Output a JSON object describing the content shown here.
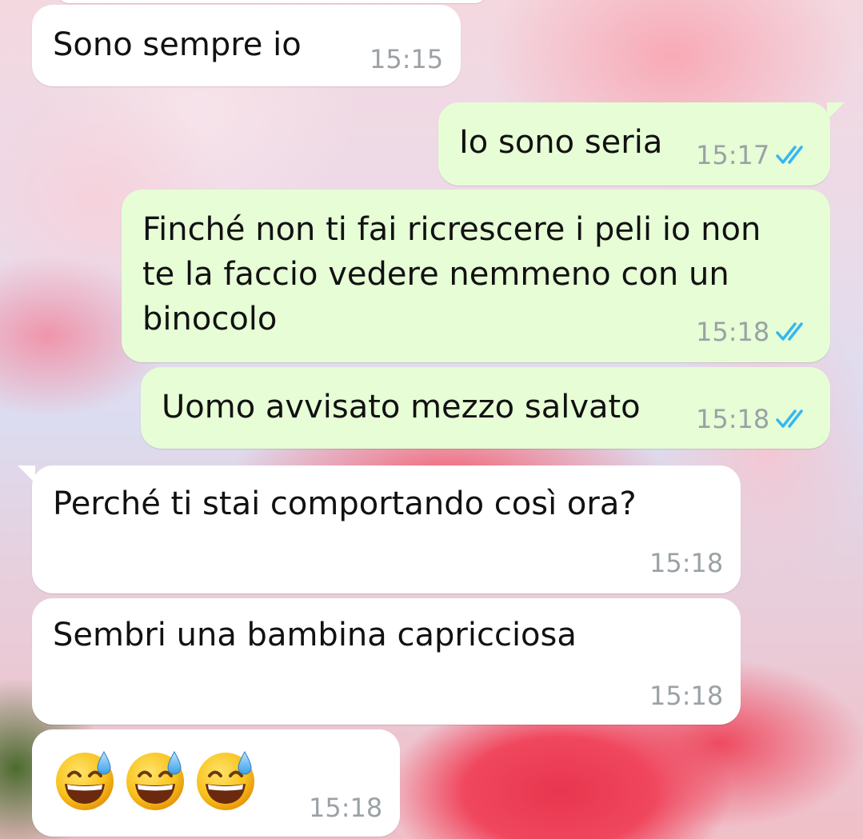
{
  "messages": [
    {
      "text": "Sono sempre io",
      "time": "15:15",
      "direction": "in"
    },
    {
      "text": "Io sono seria",
      "time": "15:17",
      "direction": "out",
      "status_icon": "double-check-read-icon"
    },
    {
      "text": "Finché non ti fai ricrescere i peli io non\nte la faccio vedere nemmeno con un\nbinocolo",
      "time": "15:18",
      "direction": "out",
      "status_icon": "double-check-read-icon"
    },
    {
      "text": "Uomo avvisato mezzo salvato",
      "time": "15:18",
      "direction": "out",
      "status_icon": "double-check-read-icon"
    },
    {
      "text": "Perché ti stai comportando così ora?",
      "time": "15:18",
      "direction": "in"
    },
    {
      "text": "Sembri una bambina capricciosa",
      "time": "15:18",
      "direction": "in"
    },
    {
      "emojis": [
        "😅",
        "😅",
        "😅"
      ],
      "emoji_icon": "grinning-face-with-sweat-icon",
      "time": "15:18",
      "direction": "in"
    }
  ],
  "colors": {
    "incoming_bubble": "#ffffff",
    "outgoing_bubble": "#e6fdd6",
    "timestamp": "#9aa2a5",
    "read_ticks": "#34b7f1"
  }
}
